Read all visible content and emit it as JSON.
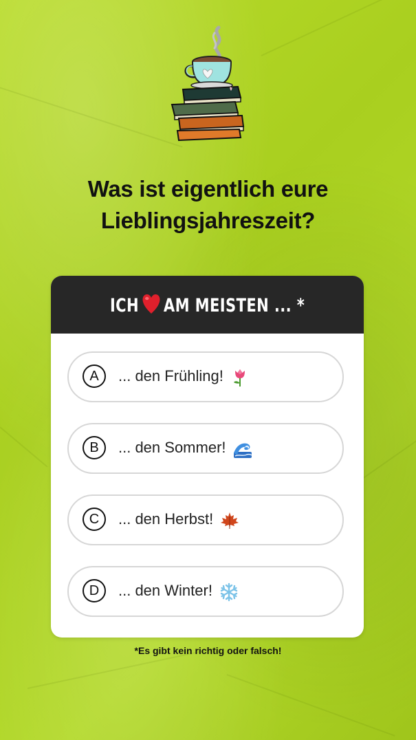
{
  "headline": {
    "line1": "Was ist eigentlich eure",
    "line2": "Lieblingsjahreszeit?"
  },
  "quiz": {
    "title_before": "ICH",
    "title_after": "AM MEISTEN ... *",
    "options": [
      {
        "letter": "A",
        "text": "... den Frühling!",
        "emoji": "tulip-icon"
      },
      {
        "letter": "B",
        "text": "... den Sommer!",
        "emoji": "wave-icon"
      },
      {
        "letter": "C",
        "text": "... den Herbst!",
        "emoji": "maple-leaf-icon"
      },
      {
        "letter": "D",
        "text": "... den Winter!",
        "emoji": "snowflake-icon"
      }
    ]
  },
  "footnote": "*Es gibt kein richtig oder falsch!",
  "colors": {
    "background": "#b3d92a",
    "header": "#272727",
    "card": "#ffffff",
    "heart": "#e0202c"
  }
}
